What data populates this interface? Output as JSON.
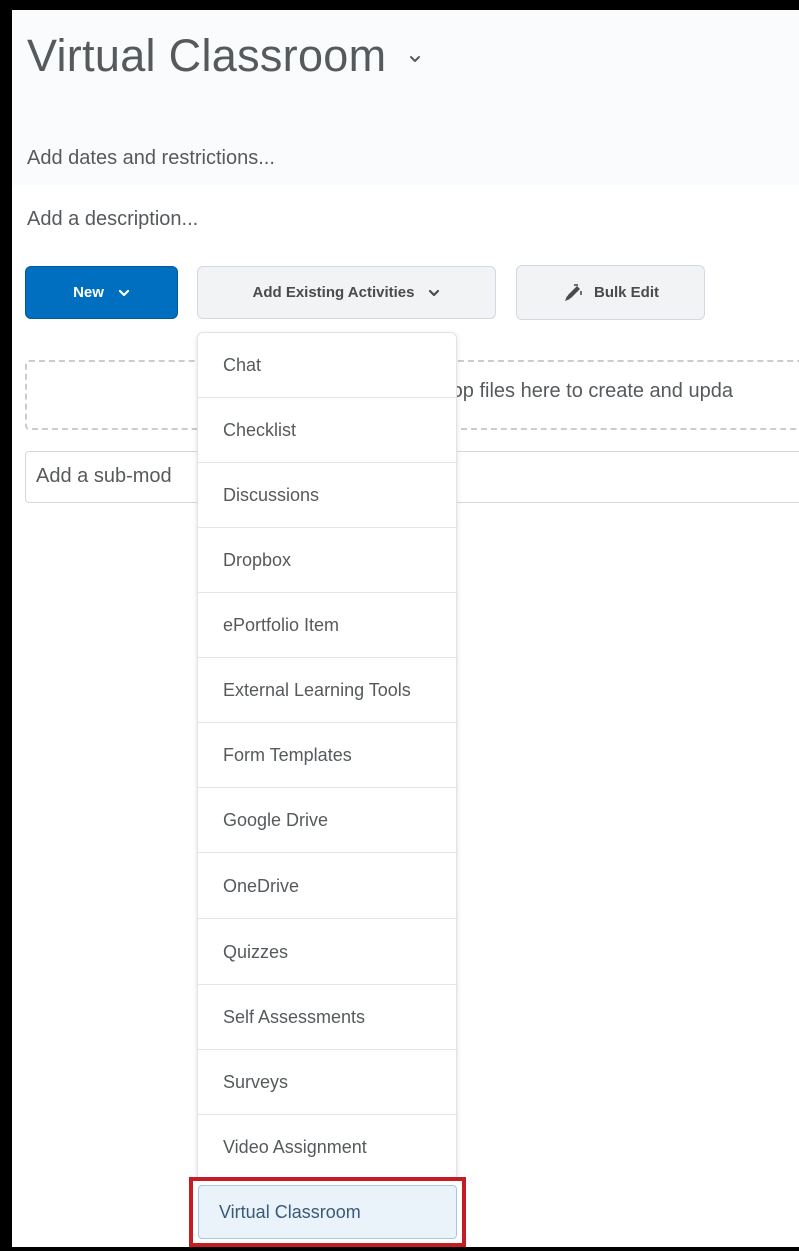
{
  "page": {
    "title": "Virtual Classroom",
    "add_dates": "Add dates and restrictions...",
    "add_description": "Add a description..."
  },
  "toolbar": {
    "new_label": "New",
    "add_existing_label": "Add Existing Activities",
    "bulk_edit_label": "Bulk Edit"
  },
  "dropzone": {
    "text": "rop files here to create and upda"
  },
  "submodule": {
    "placeholder": "Add a sub-mod"
  },
  "menu": {
    "items": [
      "Chat",
      "Checklist",
      "Discussions",
      "Dropbox",
      "ePortfolio Item",
      "External Learning Tools",
      "Form Templates",
      "Google Drive",
      "OneDrive",
      "Quizzes",
      "Self Assessments",
      "Surveys",
      "Video Assignment",
      "Virtual Classroom"
    ],
    "highlighted_item": "Virtual Classroom"
  },
  "colors": {
    "primary": "#006fbf",
    "highlight_border": "#c41e24",
    "highlight_fill": "#eaf2fa"
  }
}
